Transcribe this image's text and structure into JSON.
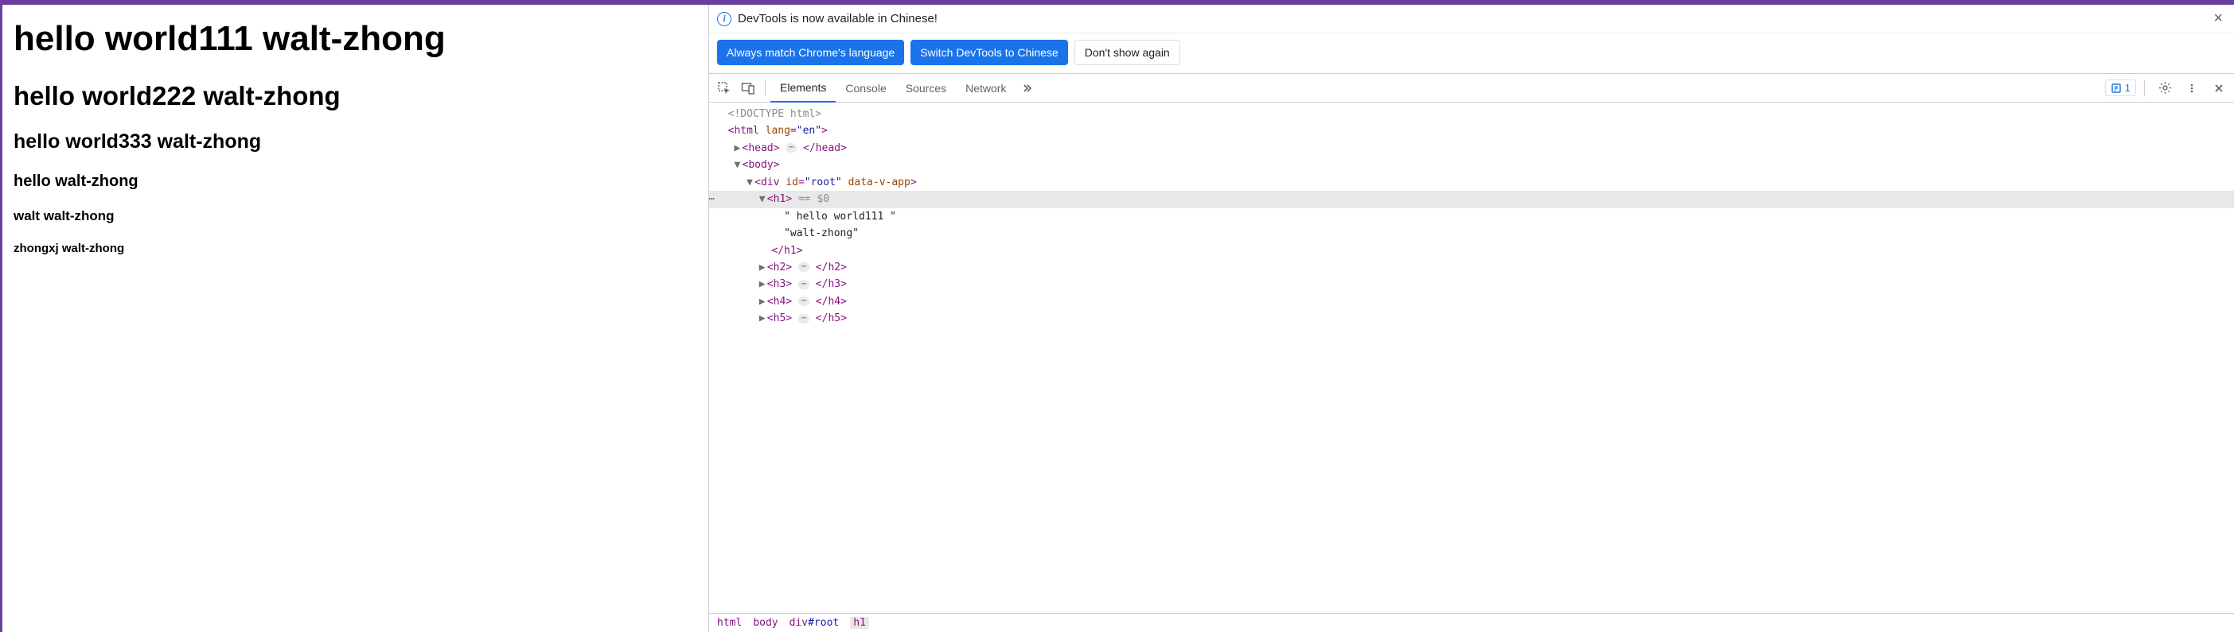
{
  "page": {
    "h1": "hello world111 walt-zhong",
    "h2": "hello world222 walt-zhong",
    "h3": "hello world333 walt-zhong",
    "h4": "hello walt-zhong",
    "h5": "walt walt-zhong",
    "h6": "zhongxj walt-zhong"
  },
  "devtools": {
    "banner": {
      "text": "DevTools is now available in Chinese!",
      "btn_match": "Always match Chrome's language",
      "btn_switch": "Switch DevTools to Chinese",
      "btn_dismiss": "Don't show again"
    },
    "tabs": {
      "elements": "Elements",
      "console": "Console",
      "sources": "Sources",
      "network": "Network"
    },
    "issues_count": "1",
    "dom": {
      "doctype": "<!DOCTYPE html>",
      "html_open": "html",
      "html_lang_attr": "lang",
      "html_lang_val": "\"en\"",
      "head": "head",
      "body": "body",
      "div": "div",
      "div_id_attr": "id",
      "div_id_val": "\"root\"",
      "div_data_attr": "data-v-app",
      "h1": "h1",
      "h1_sel": "== $0",
      "h1_text1": "\" hello world111 \"",
      "h1_text2": "\"walt-zhong\"",
      "h2": "h2",
      "h3": "h3",
      "h4": "h4",
      "h5": "h5"
    },
    "breadcrumb": {
      "b1": "html",
      "b2": "body",
      "b3_tag": "div",
      "b3_id": "#root",
      "b4": "h1"
    }
  }
}
